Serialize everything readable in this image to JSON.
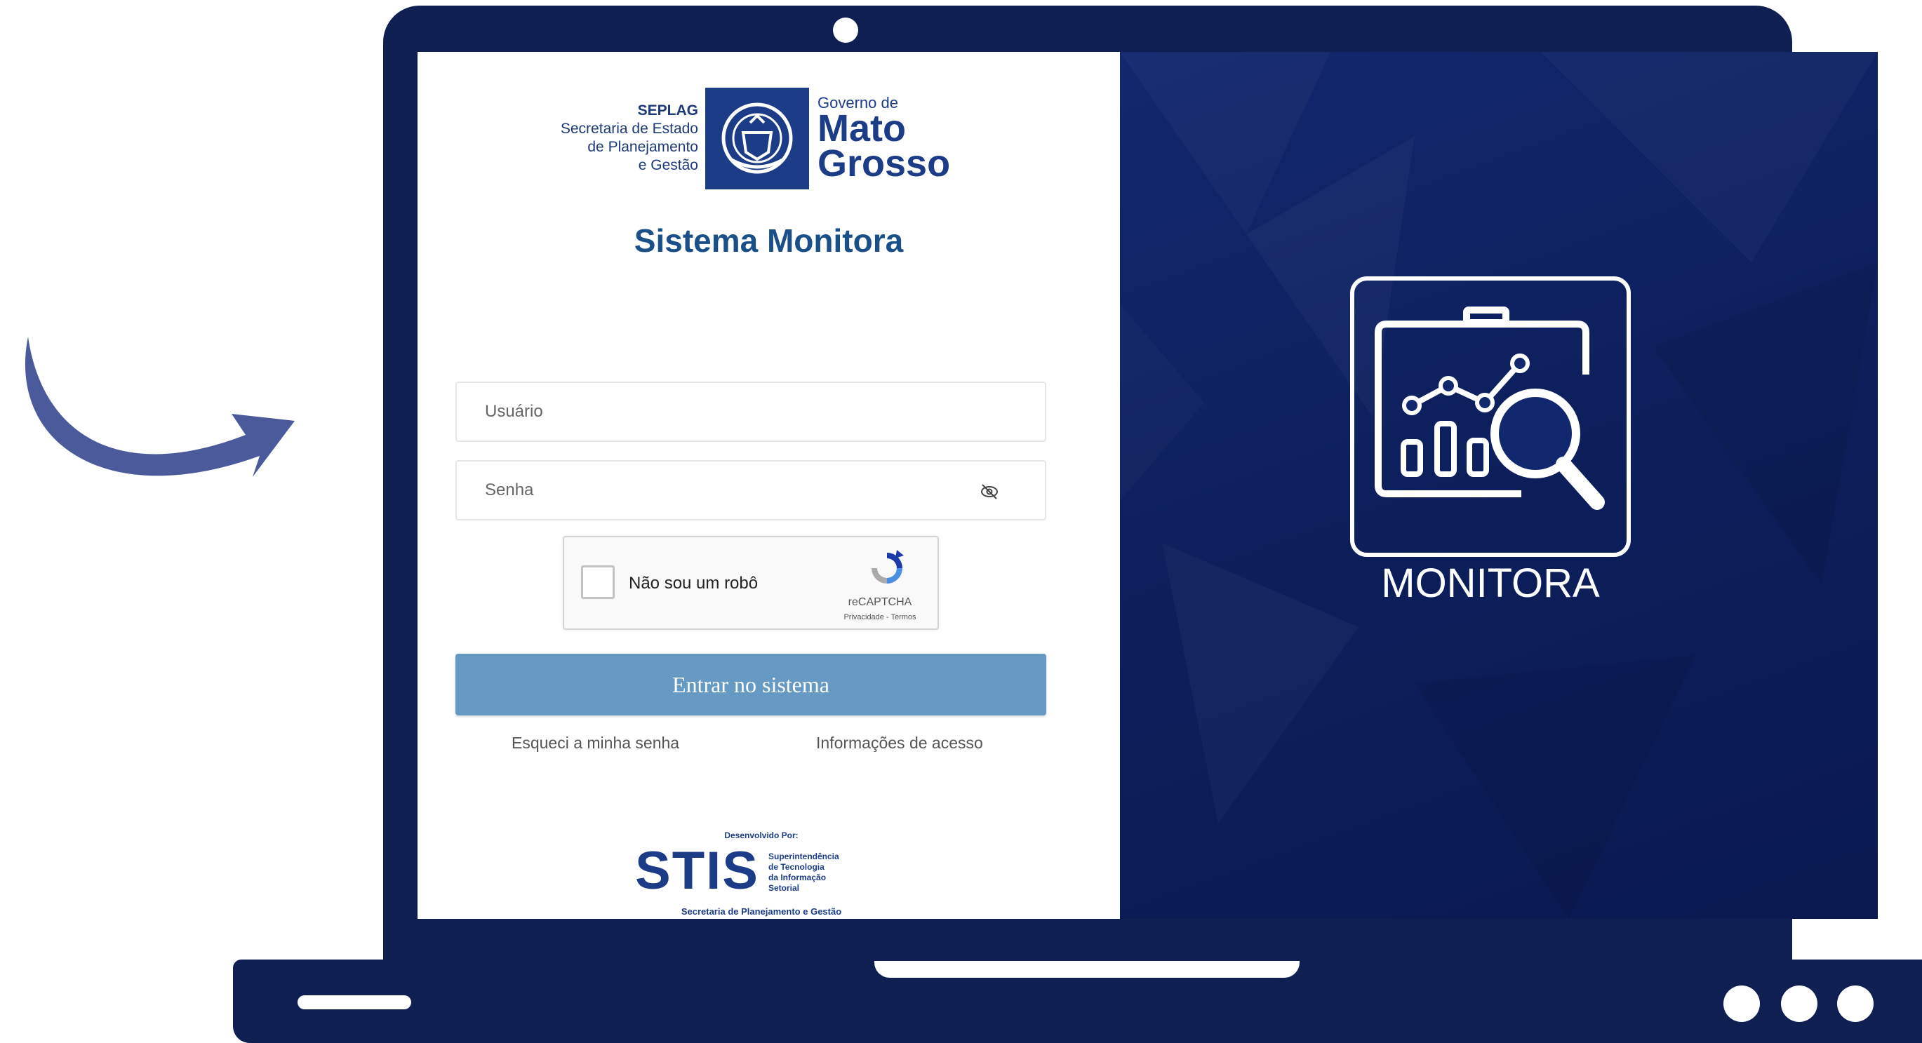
{
  "header": {
    "seplag_abbr": "SEPLAG",
    "seplag_line1": "Secretaria de Estado",
    "seplag_line2": "de Planejamento",
    "seplag_line3": "e Gestão",
    "gov_small": "Governo de",
    "gov_line1": "Mato",
    "gov_line2": "Grosso"
  },
  "login": {
    "title": "Sistema Monitora",
    "username_placeholder": "Usuário",
    "password_placeholder": "Senha",
    "captcha_label": "Não sou um robô",
    "captcha_brand": "reCAPTCHA",
    "captcha_links": "Privacidade - Termos",
    "submit_label": "Entrar no sistema",
    "forgot_link": "Esqueci a minha senha",
    "info_link": "Informações de acesso"
  },
  "footer": {
    "developed_by": "Desenvolvido Por:",
    "stis": "STIS",
    "stis_sub1": "Superintendência",
    "stis_sub2": "de Tecnologia",
    "stis_sub3": "da Informação",
    "stis_sub4": "Setorial",
    "stis_foot": "Secretaria de Planejamento e Gestão"
  },
  "brand_panel": {
    "app_name": "MONITORA"
  },
  "colors": {
    "laptop": "#0f1f52",
    "button": "#6699c4",
    "title": "#1a4f8a",
    "arrow": "#4a5a9a"
  },
  "icons": [
    "curved-arrow-icon",
    "state-emblem-icon",
    "eye-off-icon",
    "recaptcha-icon",
    "monitora-dashboard-icon"
  ]
}
